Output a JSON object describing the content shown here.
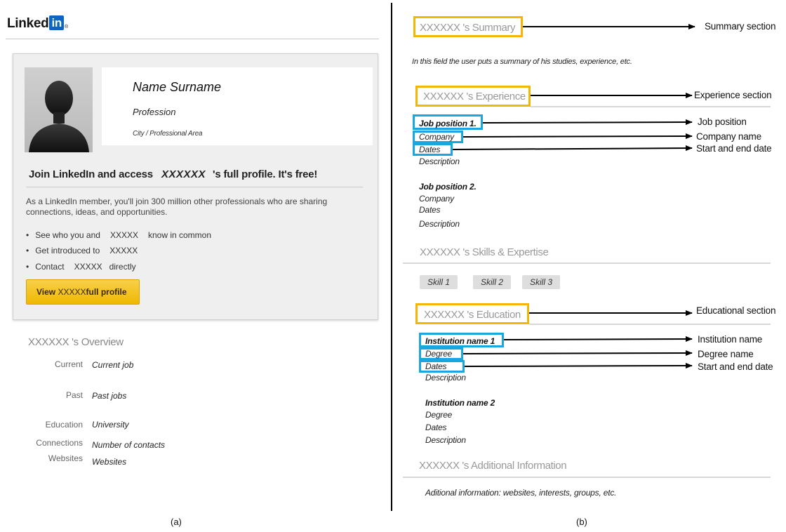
{
  "left": {
    "logo": {
      "text": "Linked",
      "badge": "in",
      "reg": "®"
    },
    "profile": {
      "name": "Name Surname",
      "profession": "Profession",
      "city": "City / Professional Area"
    },
    "join": {
      "prefix": "Join LinkedIn and access",
      "name": "XXXXXX",
      "suffix": "'s full profile. It's free!"
    },
    "intro": "As a LinkedIn member, you'll join 300 million other professionals who are sharing connections, ideas, and opportunities.",
    "bullets": {
      "b1": {
        "a": "See who you and",
        "name": "XXXXX",
        "b": "know in common"
      },
      "b2": {
        "a": "Get introduced to",
        "name": "XXXXX"
      },
      "b3": {
        "a": "Contact",
        "name": "XXXXX",
        "b": "directly"
      }
    },
    "button": {
      "a": "View",
      "name": "XXXXX",
      "b": "full profile"
    },
    "overview": {
      "title": "XXXXXX 's Overview",
      "rows": [
        {
          "label": "Current",
          "value": "Current job"
        },
        {
          "label": "Past",
          "value": "Past jobs"
        },
        {
          "label": "Education",
          "value": "University"
        },
        {
          "label": "Connections",
          "value": "Number of contacts"
        },
        {
          "label": "Websites",
          "value": "Websites"
        }
      ]
    },
    "caption": "(a)"
  },
  "right": {
    "summary": {
      "title": "XXXXXX 's Summary",
      "annotation": "Summary section",
      "text": "In this field the user puts a summary of his studies, experience, etc."
    },
    "experience": {
      "title": "XXXXXX 's Experience",
      "annotation": "Experience section",
      "jobs": [
        {
          "position": "Job position 1.",
          "company": "Company",
          "dates": "Dates",
          "description": "Description"
        },
        {
          "position": "Job position 2.",
          "company": "Company",
          "dates": "Dates",
          "description": "Description"
        }
      ],
      "annotations": {
        "position": "Job position",
        "company": "Company name",
        "dates": "Start and end date"
      }
    },
    "skills": {
      "title": "XXXXXX 's Skills & Expertise",
      "items": [
        "Skill 1",
        "Skill 2",
        "Skill 3"
      ]
    },
    "education": {
      "title": "XXXXXX 's Education",
      "annotation": "Educational section",
      "institutions": [
        {
          "name": "Institution name 1",
          "degree": "Degree",
          "dates": "Dates",
          "description": "Description"
        },
        {
          "name": "Institution name 2",
          "degree": "Degree",
          "dates": "Dates",
          "description": "Description"
        }
      ],
      "annotations": {
        "institution": "Institution name",
        "degree": "Degree name",
        "dates": "Start and end date"
      }
    },
    "additional": {
      "title": "XXXXXX 's Additional Information",
      "text": "Aditional information: websites, interests, groups, etc."
    },
    "caption": "(b)"
  },
  "colors": {
    "highlight_box": "#f2b705",
    "field_box": "#1aa7e0",
    "button": "#f5c518",
    "logo_badge": "#0a66c2"
  }
}
